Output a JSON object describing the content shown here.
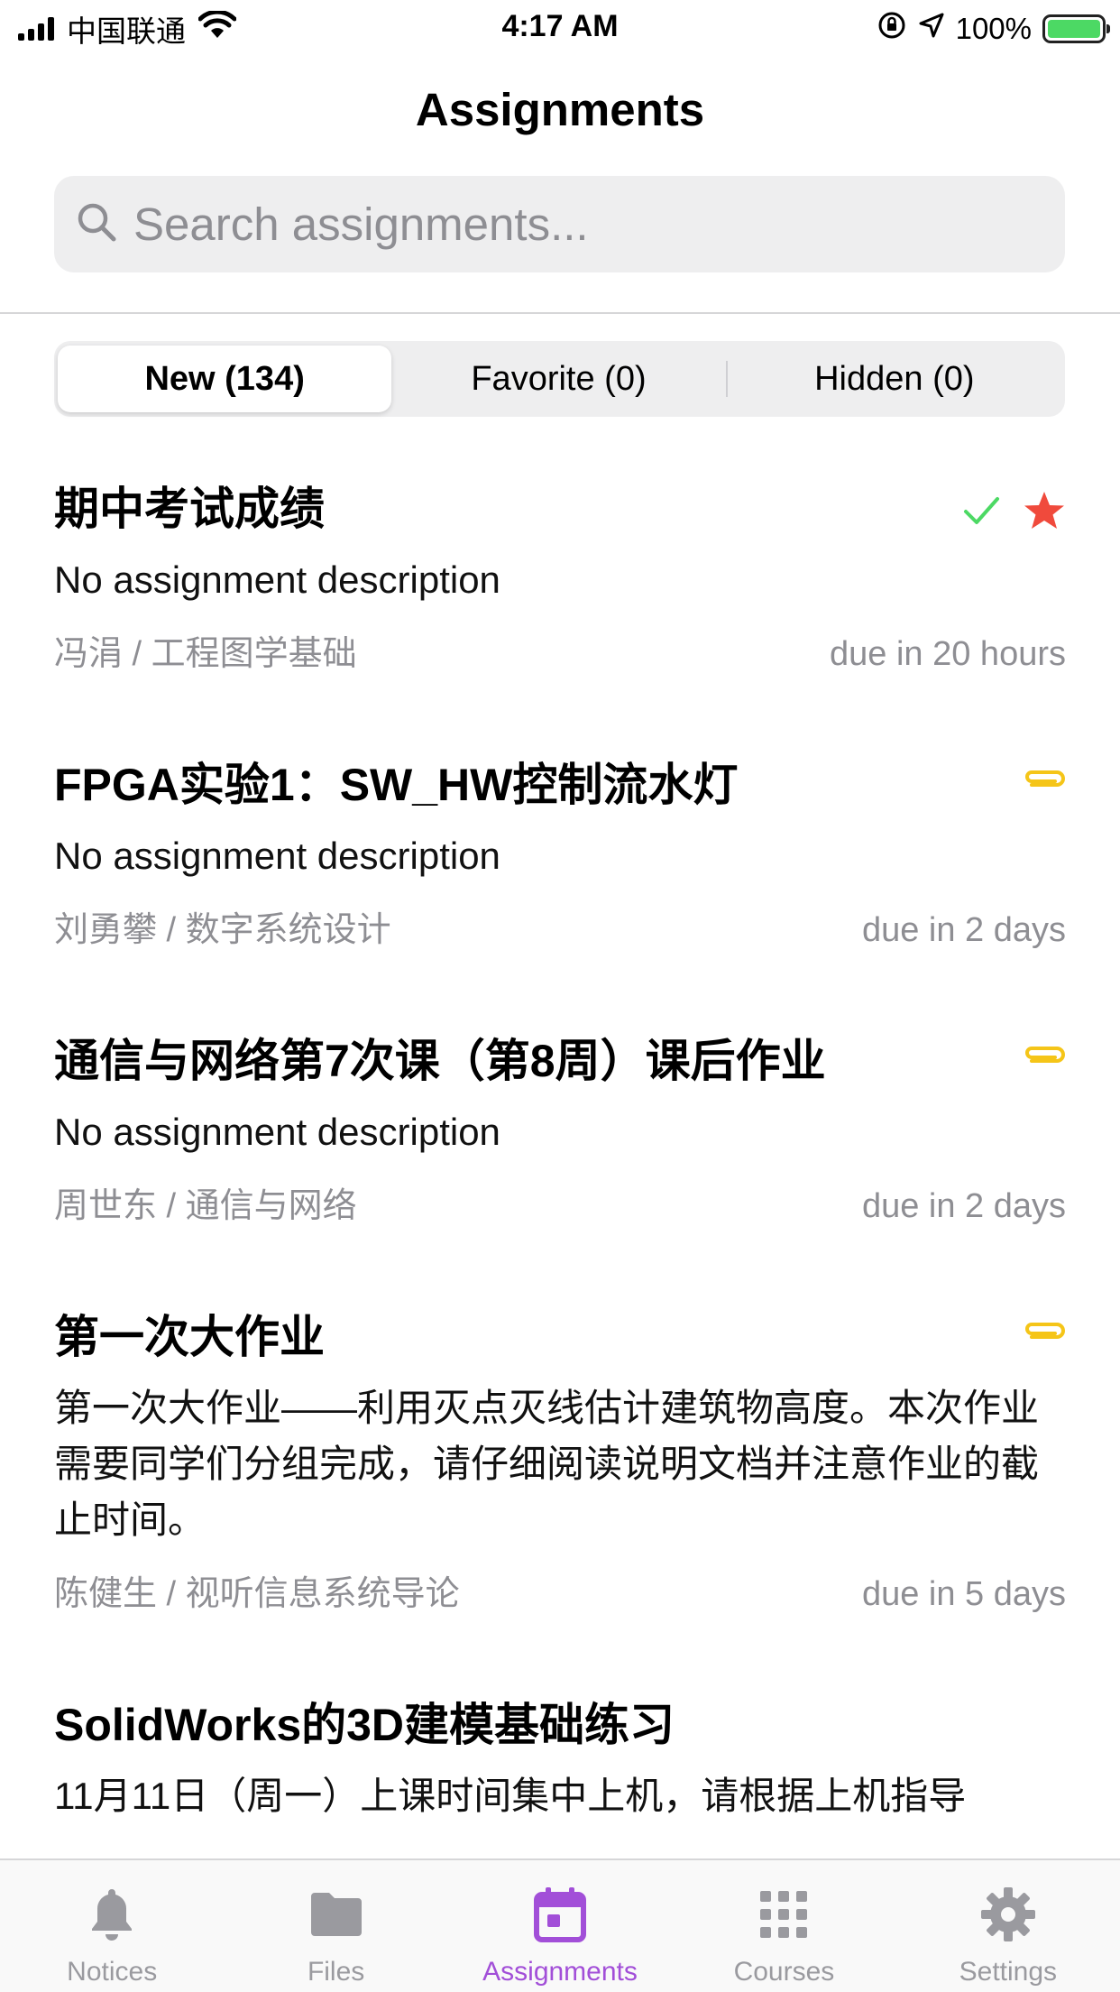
{
  "status_bar": {
    "carrier": "中国联通",
    "time": "4:17 AM",
    "battery": "100%",
    "battery_level": 1.0
  },
  "header": {
    "title": "Assignments"
  },
  "search": {
    "placeholder": "Search assignments..."
  },
  "segments": [
    {
      "label": "New (134)",
      "active": true
    },
    {
      "label": "Favorite (0)",
      "active": false
    },
    {
      "label": "Hidden (0)",
      "active": false
    }
  ],
  "assignments": [
    {
      "title": "期中考试成绩",
      "description": "No assignment description",
      "meta": "冯涓 / 工程图学基础",
      "due": "due in 20 hours",
      "icons": [
        "checkmark-icon",
        "star-icon"
      ]
    },
    {
      "title": "FPGA实验1：SW_HW控制流水灯",
      "description": "No assignment description",
      "meta": "刘勇攀 / 数字系统设计",
      "due": "due in 2 days",
      "icons": [
        "paperclip-icon"
      ]
    },
    {
      "title": "通信与网络第7次课（第8周）课后作业",
      "description": "No assignment description",
      "meta": "周世东 / 通信与网络",
      "due": "due in 2 days",
      "icons": [
        "paperclip-icon"
      ]
    },
    {
      "title": "第一次大作业",
      "description": "第一次大作业——利用灭点灭线估计建筑物高度。本次作业需要同学们分组完成，请仔细阅读说明文档并注意作业的截止时间。",
      "meta": "陈健生 / 视听信息系统导论",
      "due": "due in 5 days",
      "icons": [
        "paperclip-icon"
      ]
    },
    {
      "title": "SolidWorks的3D建模基础练习",
      "description": "11月11日（周一）上课时间集中上机，请根据上机指导",
      "meta": "",
      "due": "",
      "icons": []
    }
  ],
  "tab_bar": [
    {
      "label": "Notices",
      "icon": "bell-icon",
      "active": false
    },
    {
      "label": "Files",
      "icon": "folder-icon",
      "active": false
    },
    {
      "label": "Assignments",
      "icon": "calendar-icon",
      "active": true
    },
    {
      "label": "Courses",
      "icon": "grid-icon",
      "active": false
    },
    {
      "label": "Settings",
      "icon": "gear-icon",
      "active": false
    }
  ],
  "colors": {
    "accent": "#a24fd8",
    "check": "#4cd964",
    "star": "#f04a3c",
    "paperclip": "#f5c518",
    "secondary_text": "#8e8e93"
  }
}
